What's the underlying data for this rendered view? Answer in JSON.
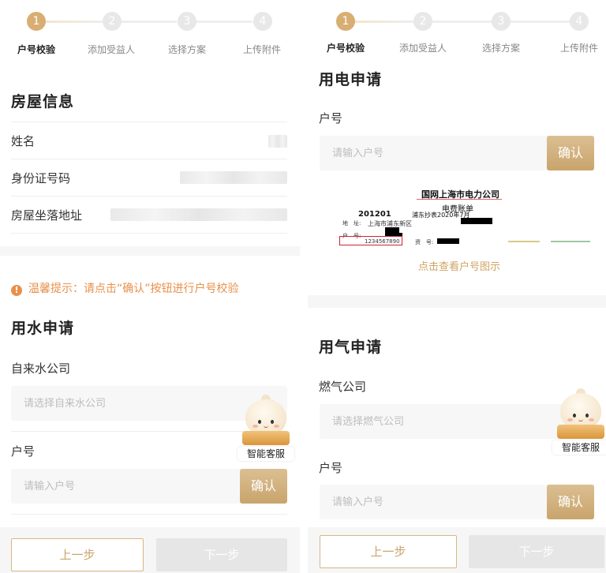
{
  "steps": [
    {
      "number": "1",
      "label": "户号校验"
    },
    {
      "number": "2",
      "label": "添加受益人"
    },
    {
      "number": "3",
      "label": "选择方案"
    },
    {
      "number": "4",
      "label": "上传附件"
    }
  ],
  "left": {
    "house_section_title": "房屋信息",
    "name_label": "姓名",
    "id_label": "身份证号码",
    "address_label": "房屋坐落地址",
    "tip_icon": "!",
    "tip_text": "温馨提示：请点击“确认”按钮进行户号校验",
    "water_section_title": "用水申请",
    "water_company_label": "自来水公司",
    "water_company_placeholder": "请选择自来水公司",
    "chevron": "›",
    "account_label": "户号",
    "account_placeholder": "请输入户号",
    "confirm_label": "确认"
  },
  "right": {
    "electric_section_title": "用电申请",
    "account_label": "户号",
    "account_placeholder": "请输入户号",
    "confirm_label": "确认",
    "bill": {
      "company": "国网上海市电力公司",
      "title": "电费账单",
      "code": "201201",
      "district": "浦东抄表2020年7月",
      "address_key": "地　址:",
      "address_value": "上海市浦东新区",
      "hid_key": "户　号:",
      "hid_value": "1234567890",
      "fee_key": "资　号:"
    },
    "bill_link": "点击查看户号图示",
    "gas_section_title": "用气申请",
    "gas_company_label": "燃气公司",
    "gas_company_placeholder": "请选择燃气公司",
    "gas_account_label": "户号",
    "gas_account_placeholder": "请输入户号",
    "gas_confirm_label": "确认"
  },
  "mascot_label": "智能客服",
  "footer": {
    "prev_label": "上一步",
    "next_label": "下一步"
  },
  "colors": {
    "accent": "#d8ae72",
    "tip": "#e8904a",
    "disabled": "#e6e6e6"
  }
}
